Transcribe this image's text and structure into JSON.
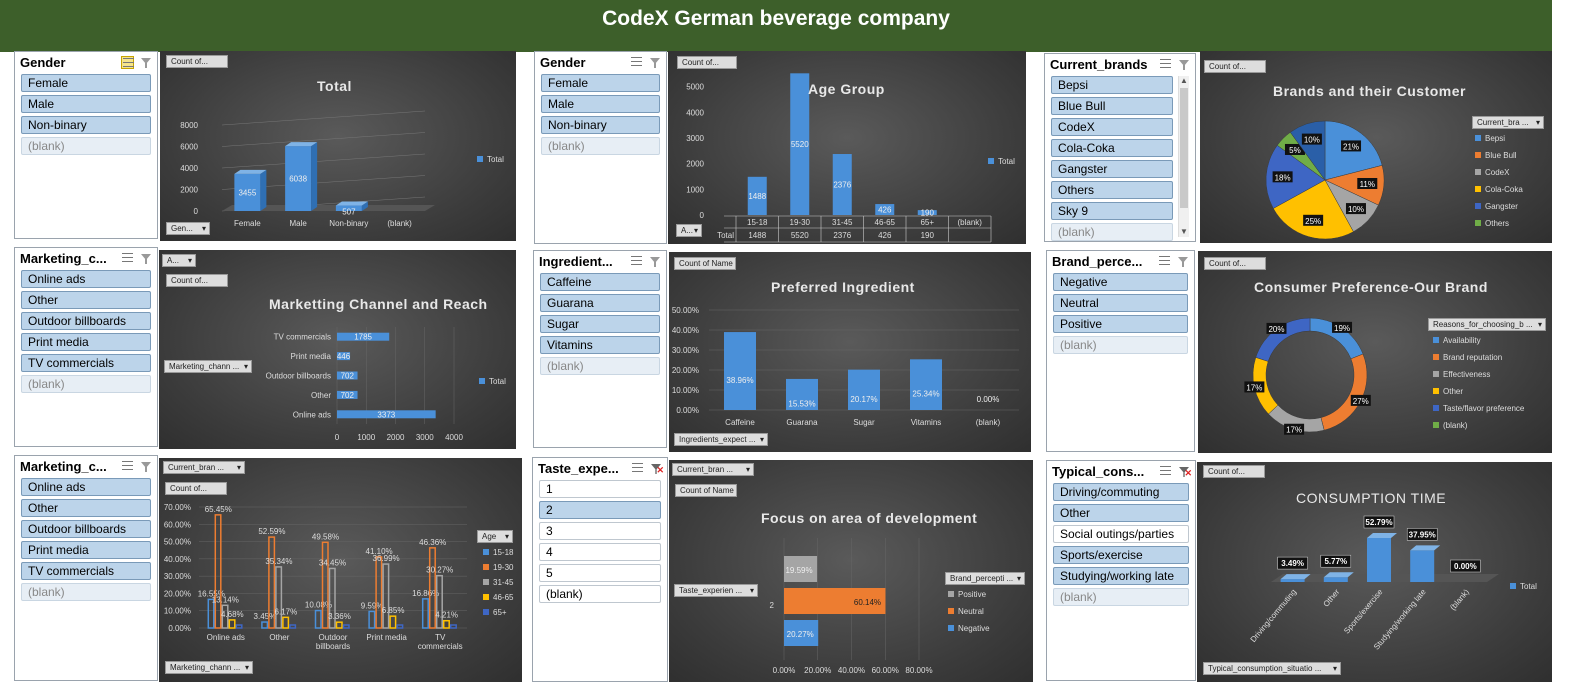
{
  "header": {
    "title": "CodeX German beverage company"
  },
  "slicers": {
    "gender1": {
      "title": "Gender",
      "items": [
        "Female",
        "Male",
        "Non-binary",
        "(blank)"
      ]
    },
    "gender2": {
      "title": "Gender",
      "items": [
        "Female",
        "Male",
        "Non-binary",
        "(blank)"
      ]
    },
    "brands": {
      "title": "Current_brands",
      "items": [
        "Bepsi",
        "Blue Bull",
        "CodeX",
        "Cola-Coka",
        "Gangster",
        "Others",
        "Sky 9",
        "(blank)"
      ]
    },
    "marketing1": {
      "title": "Marketing_c...",
      "items": [
        "Online ads",
        "Other",
        "Outdoor billboards",
        "Print media",
        "TV commercials",
        "(blank)"
      ]
    },
    "ingredients": {
      "title": "Ingredient...",
      "items": [
        "Caffeine",
        "Guarana",
        "Sugar",
        "Vitamins",
        "(blank)"
      ]
    },
    "brandperc": {
      "title": "Brand_perce...",
      "items": [
        "Negative",
        "Neutral",
        "Positive",
        "(blank)"
      ]
    },
    "marketing2": {
      "title": "Marketing_c...",
      "items": [
        "Online ads",
        "Other",
        "Outdoor billboards",
        "Print media",
        "TV commercials",
        "(blank)"
      ]
    },
    "taste": {
      "title": "Taste_expe...",
      "items": [
        "1",
        "2",
        "3",
        "4",
        "5",
        "(blank)"
      ]
    },
    "consumption": {
      "title": "Typical_cons...",
      "items": [
        "Driving/commuting",
        "Other",
        "Social outings/parties",
        "Sports/exercise",
        "Studying/working late",
        "(blank)"
      ]
    }
  },
  "pivot_buttons": {
    "count_of": "Count of...",
    "count_of_name": "Count of Name",
    "gen": "Gen...",
    "age_a": "A...",
    "a": "A...",
    "marketing_chann": "Marketing_chann ...",
    "current_bran": "Current_bran ...",
    "brand_legend": "Current_bra ...",
    "reasons": "Reasons_for_choosing_b ...",
    "ingredients_expect": "Ingredients_expect ...",
    "taste_experien": "Taste_experien ...",
    "brand_percepti": "Brand_percepti ...",
    "typical_consumption": "Typical_consumption_situatio ...",
    "age": "Age"
  },
  "chart_data": [
    {
      "id": "total",
      "type": "bar",
      "title": "Total",
      "categories": [
        "Female",
        "Male",
        "Non-binary",
        "(blank)"
      ],
      "values": [
        3455,
        6038,
        507,
        0
      ],
      "ylim": [
        0,
        8000
      ],
      "yticks": [
        0,
        2000,
        4000,
        6000,
        8000
      ],
      "legend": [
        "Total"
      ],
      "color": "#4a90d9"
    },
    {
      "id": "age",
      "type": "bar",
      "title": "Age Group",
      "categories": [
        "15-18",
        "19-30",
        "31-45",
        "46-65",
        "65+",
        "(blank)"
      ],
      "values": [
        1488,
        5520,
        2376,
        426,
        190,
        null
      ],
      "ylim": [
        0,
        6000
      ],
      "yticks": [
        0,
        1000,
        2000,
        3000,
        4000,
        5000
      ],
      "table_row_label": "Total",
      "legend": [
        "Total"
      ],
      "color": "#4a90d9"
    },
    {
      "id": "brands",
      "type": "pie",
      "title": "Brands and their Customer",
      "categories": [
        "Bepsi",
        "Blue Bull",
        "CodeX",
        "Cola-Coka",
        "Gangster",
        "Others"
      ],
      "values": [
        21,
        11,
        10,
        25,
        18,
        5
      ],
      "extra": [
        {
          "label": "10%",
          "value": 10
        }
      ],
      "labels": [
        "21%",
        "11%",
        "10%",
        "25%",
        "18%",
        "5%",
        "10%"
      ],
      "colors": [
        "#4a90d9",
        "#ed7d31",
        "#a5a5a5",
        "#ffc000",
        "#3e66c4",
        "#70ad47",
        "#2a5fa8"
      ]
    },
    {
      "id": "marketing",
      "type": "bar",
      "orientation": "horizontal",
      "title": "Marketting Channel and Reach",
      "categories": [
        "TV commercials",
        "Print media",
        "Outdoor billboards",
        "Other",
        "Online ads"
      ],
      "values": [
        1785,
        446,
        702,
        702,
        3373
      ],
      "xlim": [
        0,
        4000
      ],
      "xticks": [
        0,
        1000,
        2000,
        3000,
        4000
      ],
      "legend": [
        "Total"
      ],
      "color": "#4a90d9"
    },
    {
      "id": "ingredient",
      "type": "bar",
      "title": "Preferred Ingredient",
      "categories": [
        "Caffeine",
        "Guarana",
        "Sugar",
        "Vitamins",
        "(blank)"
      ],
      "values": [
        38.96,
        15.53,
        20.17,
        25.34,
        0.0
      ],
      "labels": [
        "38.96%",
        "15.53%",
        "20.17%",
        "25.34%",
        "0.00%"
      ],
      "ylim": [
        0,
        50
      ],
      "yticks": [
        "0.00%",
        "10.00%",
        "20.00%",
        "30.00%",
        "40.00%",
        "50.00%"
      ],
      "color": "#4a90d9"
    },
    {
      "id": "preference",
      "type": "pie",
      "subtype": "doughnut",
      "title": "Consumer Preference-Our Brand",
      "categories": [
        "Availability",
        "Brand reputation",
        "Effectiveness",
        "Other",
        "Taste/flavor preference",
        "(blank)"
      ],
      "values": [
        19,
        27,
        17,
        17,
        20,
        0
      ],
      "labels": [
        "19%",
        "27%",
        "17%",
        "17%",
        "20%"
      ],
      "colors": [
        "#4a90d9",
        "#ed7d31",
        "#a5a5a5",
        "#ffc000",
        "#3e66c4",
        "#70ad47"
      ]
    },
    {
      "id": "marketing_age",
      "type": "bar",
      "categories": [
        "Online ads",
        "Other",
        "Outdoor billboards",
        "Print media",
        "TV commercials"
      ],
      "series": [
        {
          "name": "15-18",
          "values": [
            16.55,
            3.45,
            10.08,
            9.59,
            16.86
          ],
          "color": "#4a90d9"
        },
        {
          "name": "19-30",
          "values": [
            65.45,
            52.59,
            49.58,
            41.1,
            46.36
          ],
          "color": "#ed7d31"
        },
        {
          "name": "31-45",
          "values": [
            13.14,
            35.34,
            34.45,
            36.99,
            30.27
          ],
          "color": "#a5a5a5"
        },
        {
          "name": "46-65",
          "values": [
            4.68,
            6.17,
            3.36,
            6.85,
            4.21
          ],
          "color": "#ffc000"
        },
        {
          "name": "65+",
          "values": [
            0,
            0,
            0,
            0,
            0
          ],
          "color": "#3e66c4"
        }
      ],
      "labels": [
        [
          "16.55%",
          "65.45%",
          "13.14%",
          "4.68%"
        ],
        [
          "3.45%",
          "52.59%",
          "35.34%",
          "6.17%"
        ],
        [
          "10.08%",
          "49.58%",
          "34.45%",
          "3.36%"
        ],
        [
          "9.59%",
          "41.10%",
          "36.99%",
          "6.85%"
        ],
        [
          "16.86%",
          "46.36%",
          "30.27%",
          "4.21%"
        ]
      ],
      "ylim": [
        0,
        70
      ],
      "yticks": [
        "0.00%",
        "10.00%",
        "20.00%",
        "30.00%",
        "40.00%",
        "50.00%",
        "60.00%",
        "70.00%"
      ],
      "legend_title": "Age"
    },
    {
      "id": "focus",
      "type": "bar",
      "orientation": "horizontal",
      "stacked": true,
      "title": "Focus on area of development",
      "categories": [
        "2"
      ],
      "series": [
        {
          "name": "Positive",
          "values": [
            19.59
          ],
          "color": "#a5a5a5"
        },
        {
          "name": "Neutral",
          "values": [
            60.14
          ],
          "color": "#ed7d31"
        },
        {
          "name": "Negative",
          "values": [
            20.27
          ],
          "color": "#4a90d9"
        }
      ],
      "labels": [
        "19.59%",
        "60.14%",
        "20.27%"
      ],
      "xlim": [
        0,
        80
      ],
      "xticks": [
        "0.00%",
        "20.00%",
        "40.00%",
        "60.00%",
        "80.00%"
      ]
    },
    {
      "id": "consumption",
      "type": "bar",
      "title": "CONSUMPTION TIME",
      "categories": [
        "Driving/commuting",
        "Other",
        "Sports/exercise",
        "Studying/working late",
        "(blank)"
      ],
      "values": [
        3.49,
        5.77,
        52.79,
        37.95,
        0.0
      ],
      "labels": [
        "3.49%",
        "5.77%",
        "52.79%",
        "37.95%",
        "0.00%"
      ],
      "legend": [
        "Total"
      ],
      "color": "#4a90d9"
    }
  ]
}
